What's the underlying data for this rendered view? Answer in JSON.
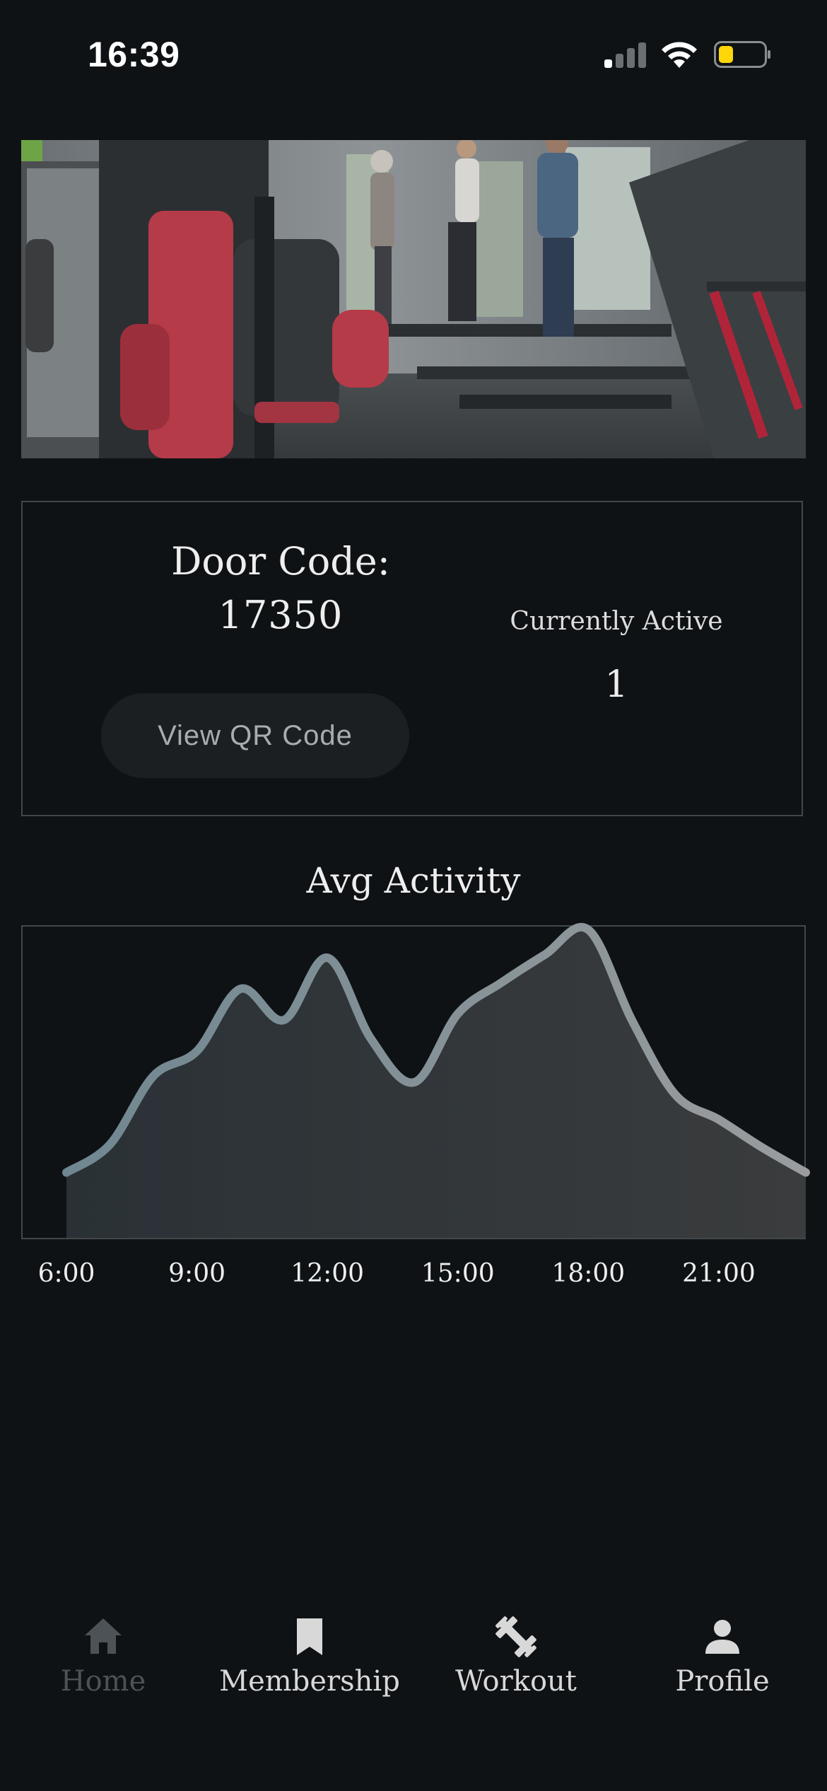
{
  "status_bar": {
    "time": "16:39"
  },
  "door": {
    "title": "Door Code:",
    "code": "17350",
    "qr_button_label": "View QR Code",
    "active_label": "Currently Active",
    "active_count": "1"
  },
  "chart_data": {
    "type": "area",
    "title": "Avg Activity",
    "xlabel": "",
    "ylabel": "",
    "x": [
      "6:00",
      "7:00",
      "8:00",
      "9:00",
      "10:00",
      "11:00",
      "12:00",
      "13:00",
      "14:00",
      "15:00",
      "16:00",
      "17:00",
      "18:00",
      "19:00",
      "20:00",
      "21:00",
      "22:00",
      "23:00"
    ],
    "values": [
      0.21,
      0.3,
      0.52,
      0.6,
      0.8,
      0.7,
      0.9,
      0.64,
      0.5,
      0.72,
      0.82,
      0.91,
      0.99,
      0.7,
      0.46,
      0.38,
      0.29,
      0.21
    ],
    "tick_labels": [
      "6:00",
      "9:00",
      "12:00",
      "15:00",
      "18:00",
      "21:00"
    ],
    "ylim": [
      0,
      1
    ],
    "grid": false,
    "line_color": "#8a959b",
    "fill_color": "#2f3538"
  },
  "tabs": [
    {
      "label": "Home",
      "icon": "home-icon",
      "active": true
    },
    {
      "label": "Membership",
      "icon": "bookmark-icon",
      "active": false
    },
    {
      "label": "Workout",
      "icon": "dumbbell-icon",
      "active": false
    },
    {
      "label": "Profile",
      "icon": "person-icon",
      "active": false
    }
  ],
  "colors": {
    "background": "#0e1215",
    "tab_active": "#4d5256",
    "tab_inactive": "#d8d8d8"
  }
}
